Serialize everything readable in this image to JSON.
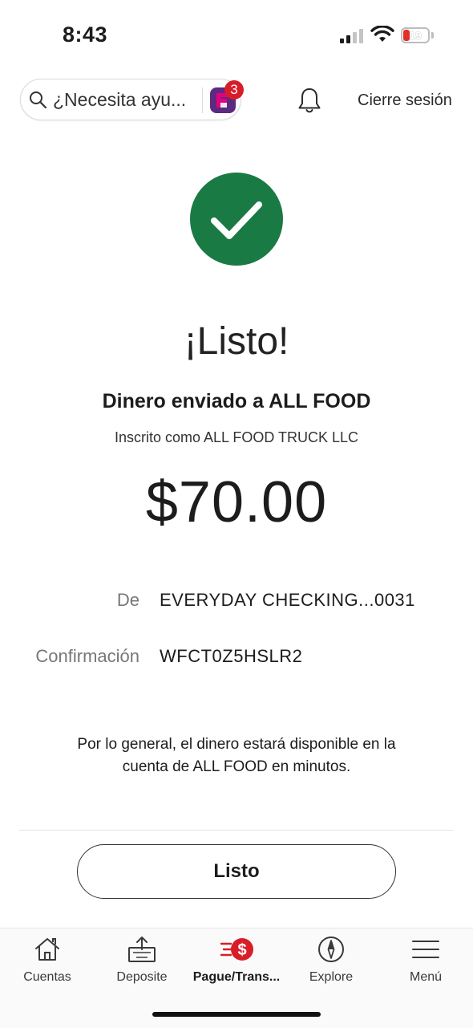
{
  "status_bar": {
    "time": "8:43",
    "battery": "19"
  },
  "header": {
    "search_placeholder": "¿Necesita ayu...",
    "assistant_badge": "3",
    "logout_label": "Cierre sesión"
  },
  "confirmation": {
    "headline": "¡Listo!",
    "sent_to": "Dinero enviado a ALL FOOD",
    "enrolled_as": "Inscrito como ALL FOOD TRUCK LLC",
    "amount": "$70.00",
    "details": [
      {
        "label": "De",
        "value": "EVERYDAY CHECKING...0031"
      },
      {
        "label": "Confirmación",
        "value": "WFCT0Z5HSLR2"
      }
    ],
    "note": "Por lo general, el dinero estará disponible en la cuenta de ALL FOOD en minutos.",
    "done_label": "Listo"
  },
  "tab_bar": {
    "items": [
      {
        "label": "Cuentas",
        "icon": "home-icon"
      },
      {
        "label": "Deposite",
        "icon": "deposit-icon"
      },
      {
        "label": "Pague/Trans...",
        "icon": "pay-transfer-icon"
      },
      {
        "label": "Explore",
        "icon": "compass-icon"
      },
      {
        "label": "Menú",
        "icon": "menu-icon"
      }
    ],
    "active": "Pague/Trans..."
  },
  "colors": {
    "success": "#1a7a44",
    "brand_red": "#d71e28",
    "assistant_purple": "#5c2a7e"
  }
}
